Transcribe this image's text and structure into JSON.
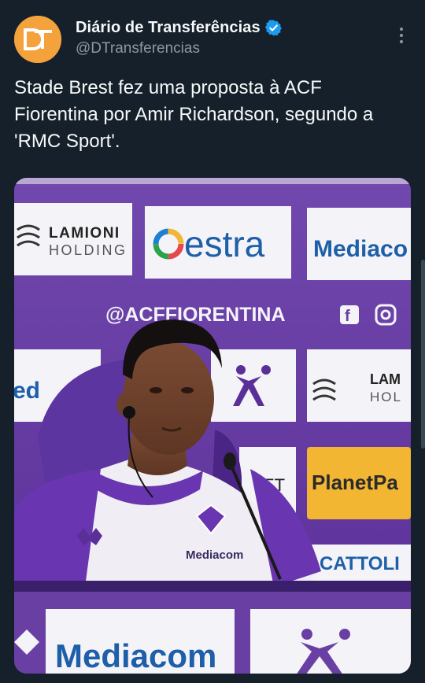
{
  "account": {
    "display_name": "Diário de Transferências",
    "handle": "@DTransferencias",
    "avatar_monogram": "DT",
    "avatar_color": "#f4a23c",
    "verified_color": "#1d9bf0"
  },
  "tweet": {
    "text": "Stade Brest fez uma proposta à ACF Fiorentina por Amir Richardson, segundo a 'RMC Sport'."
  },
  "media": {
    "backdrop_handle": "@ACFFIORENTINA",
    "sponsors": {
      "lamioni_line1": "LAMIONI",
      "lamioni_line2": "HOLDING",
      "estra": "estra",
      "mediacom": "Mediaco",
      "mediacom_bottom": "Mediacom",
      "planetpay": "PlanetPa",
      "cattolica": "CATTOLI",
      "lam_right_1": "LAM",
      "lam_right_2": "HOL",
      "et_fragment": "ET",
      "ed_fragment": "ed",
      "shirt_sponsor": "Mediacom"
    },
    "colors": {
      "purple": "#6a3fa4",
      "purple_dark": "#4b2585",
      "board_white": "#f4f3f8",
      "planet_yellow": "#f2b632"
    }
  },
  "icons": {
    "more": "more-vertical-icon",
    "verified": "verified-badge-icon",
    "facebook": "facebook-icon",
    "instagram": "instagram-icon"
  }
}
